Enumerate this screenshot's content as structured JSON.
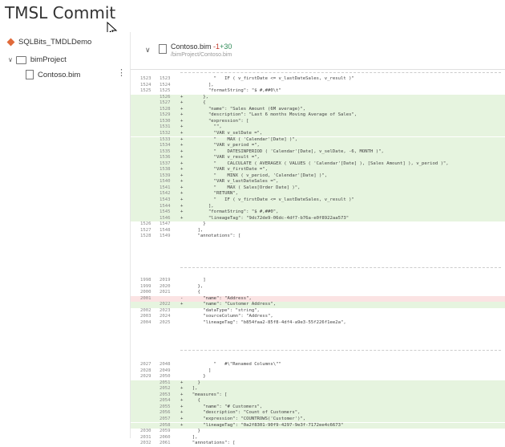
{
  "title": "TMSL Commit",
  "sidebar": {
    "repo": "SQLBits_TMDLDemo",
    "folder": "bimProject",
    "file": "Contoso.bim"
  },
  "file_header": {
    "name": "Contoso.bim",
    "deleted": "-1",
    "added": "+30",
    "path": "/bimProject/Contoso.bim"
  },
  "hunks": [
    {
      "lines": [
        {
          "o": "1523",
          "n": "1523",
          "m": "",
          "t": "          \"   IF ( v_firstDate <= v_lastDateSales, v_result )\""
        },
        {
          "o": "1524",
          "n": "1524",
          "m": "",
          "t": "        ],"
        },
        {
          "o": "1525",
          "n": "1525",
          "m": "",
          "t": "        \"formatString\": \"$ #,##0\\t\""
        },
        {
          "o": "",
          "n": "1526",
          "m": "+",
          "t": "      },"
        },
        {
          "o": "",
          "n": "1527",
          "m": "+",
          "t": "      {"
        },
        {
          "o": "",
          "n": "1528",
          "m": "+",
          "t": "        \"name\": \"Sales Amount (6M average)\","
        },
        {
          "o": "",
          "n": "1529",
          "m": "+",
          "t": "        \"description\": \"Last 6 months Moving Average of Sales\","
        },
        {
          "o": "",
          "n": "1530",
          "m": "+",
          "t": "        \"expression\": ["
        },
        {
          "o": "",
          "n": "1531",
          "m": "+",
          "t": "          \"\","
        },
        {
          "o": "",
          "n": "1532",
          "m": "+",
          "t": "          \"VAR v_selDate =\","
        },
        {
          "o": "",
          "n": "1533",
          "m": "+",
          "t": "          \"    MAX ( 'Calendar'[Date] )\","
        },
        {
          "o": "",
          "n": "1534",
          "m": "+",
          "t": "          \"VAR v_period =\","
        },
        {
          "o": "",
          "n": "1535",
          "m": "+",
          "t": "          \"    DATESINPERIOD ( 'Calendar'[Date], v_selDate, -6, MONTH )\","
        },
        {
          "o": "",
          "n": "1536",
          "m": "+",
          "t": "          \"VAR v_result =\","
        },
        {
          "o": "",
          "n": "1537",
          "m": "+",
          "t": "          \"    CALCULATE ( AVERAGEX ( VALUES ( 'Calendar'[Date] ), [Sales Amount] ), v_period )\","
        },
        {
          "o": "",
          "n": "1538",
          "m": "+",
          "t": "          \"VAR v_firstDate =\","
        },
        {
          "o": "",
          "n": "1539",
          "m": "+",
          "t": "          \"    MINX ( v_period, 'Calendar'[Date] )\","
        },
        {
          "o": "",
          "n": "1540",
          "m": "+",
          "t": "          \"VAR v_lastDateSales =\","
        },
        {
          "o": "",
          "n": "1541",
          "m": "+",
          "t": "          \"    MAX ( Sales[Order Date] )\","
        },
        {
          "o": "",
          "n": "1542",
          "m": "+",
          "t": "          \"RETURN\","
        },
        {
          "o": "",
          "n": "1543",
          "m": "+",
          "t": "          \"   IF ( v_firstDate <= v_lastDateSales, v_result )\""
        },
        {
          "o": "",
          "n": "1544",
          "m": "+",
          "t": "        ],"
        },
        {
          "o": "",
          "n": "1545",
          "m": "+",
          "t": "        \"formatString\": \"$ #,##0\","
        },
        {
          "o": "",
          "n": "1546",
          "m": "+",
          "t": "        \"lineageTag\": \"9dc72de9-06dc-4df7-b76a-e0f8922aa573\""
        },
        {
          "o": "1526",
          "n": "1547",
          "m": "",
          "t": "      }"
        },
        {
          "o": "1527",
          "n": "1548",
          "m": "",
          "t": "    ],"
        },
        {
          "o": "1528",
          "n": "1549",
          "m": "",
          "t": "    \"annotations\": ["
        }
      ]
    },
    {
      "lines": [
        {
          "o": "1998",
          "n": "2019",
          "m": "",
          "t": "      ]"
        },
        {
          "o": "1999",
          "n": "2020",
          "m": "",
          "t": "    },"
        },
        {
          "o": "2000",
          "n": "2021",
          "m": "",
          "t": "    {"
        },
        {
          "o": "2001",
          "n": "",
          "m": "-",
          "t": "      \"name\": \"Address\","
        },
        {
          "o": "",
          "n": "2022",
          "m": "+",
          "t": "      \"name\": \"Customer Address\","
        },
        {
          "o": "2002",
          "n": "2023",
          "m": "",
          "t": "      \"dataType\": \"string\","
        },
        {
          "o": "2003",
          "n": "2024",
          "m": "",
          "t": "      \"sourceColumn\": \"Address\","
        },
        {
          "o": "2004",
          "n": "2025",
          "m": "",
          "t": "      \"lineageTag\": \"b854faa2-85f8-4df4-a9e3-55f226f1ee2a\","
        }
      ]
    },
    {
      "lines": [
        {
          "o": "2027",
          "n": "2048",
          "m": "",
          "t": "          \"   #\\\"Renamed Columns\\\"\""
        },
        {
          "o": "2028",
          "n": "2049",
          "m": "",
          "t": "        ]"
        },
        {
          "o": "2029",
          "n": "2050",
          "m": "",
          "t": "      }"
        },
        {
          "o": "",
          "n": "2051",
          "m": "+",
          "t": "    }"
        },
        {
          "o": "",
          "n": "2052",
          "m": "+",
          "t": "  ],"
        },
        {
          "o": "",
          "n": "2053",
          "m": "+",
          "t": "  \"measures\": ["
        },
        {
          "o": "",
          "n": "2054",
          "m": "+",
          "t": "    {"
        },
        {
          "o": "",
          "n": "2055",
          "m": "+",
          "t": "      \"name\": \"# Customers\","
        },
        {
          "o": "",
          "n": "2056",
          "m": "+",
          "t": "      \"description\": \"Count of Customers\","
        },
        {
          "o": "",
          "n": "2057",
          "m": "+",
          "t": "      \"expression\": \"COUNTROWS('Customer')\","
        },
        {
          "o": "",
          "n": "2058",
          "m": "+",
          "t": "      \"lineageTag\": \"0a2f8301-90f9-4297-9e3f-7172ee4c6673\""
        },
        {
          "o": "2030",
          "n": "2059",
          "m": "",
          "t": "    }"
        },
        {
          "o": "2031",
          "n": "2060",
          "m": "",
          "t": "  ],"
        },
        {
          "o": "2032",
          "n": "2061",
          "m": "",
          "t": "  \"annotations\": ["
        }
      ]
    }
  ],
  "colors": {
    "added_bg": "#e6f4df",
    "deleted_bg": "#fbe3e3",
    "repo_icon": "#e06a3a"
  }
}
